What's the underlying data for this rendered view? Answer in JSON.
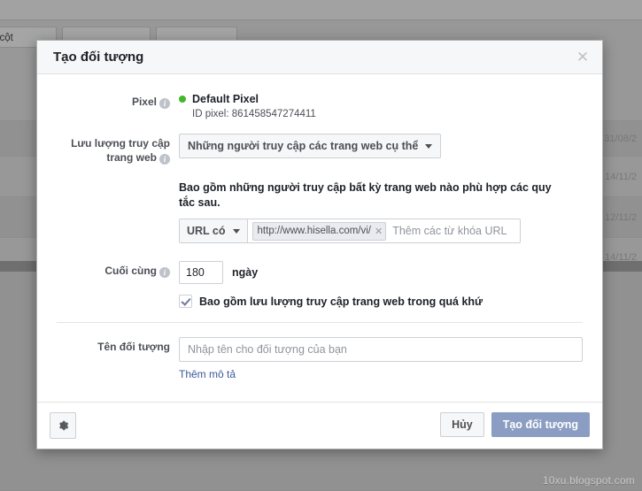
{
  "modal": {
    "title": "Tạo đối tượng",
    "close_icon": "close-icon",
    "pixel": {
      "label": "Pixel",
      "info_glyph": "i",
      "status_color": "#42b72a",
      "name": "Default Pixel",
      "id_text": "ID pixel: 861458547274411"
    },
    "traffic": {
      "label_line1": "Lưu lượng truy cập",
      "label_line2": "trang web",
      "info_glyph": "i",
      "selected_option": "Những người truy cập các trang web cụ thể"
    },
    "rule": {
      "description": "Bao gồm những người truy cập bất kỳ trang web nào phù hợp các quy tắc sau.",
      "operator": "URL có",
      "token_value": "http://www.hisella.com/vi/",
      "token_remove_icon": "remove-token-icon",
      "keywords_placeholder": "Thêm các từ khóa URL"
    },
    "duration": {
      "label": "Cuối cùng",
      "info_glyph": "i",
      "value": "180",
      "unit": "ngày",
      "checkbox_checked": true,
      "checkbox_label": "Bao gồm lưu lượng truy cập trang web trong quá khứ"
    },
    "audience_name": {
      "label": "Tên đối tượng",
      "value": "",
      "placeholder": "Nhập tên cho đối tượng của bạn",
      "add_description_link": "Thêm mô tả"
    },
    "footer": {
      "gear_icon": "gear-icon",
      "cancel_label": "Hủy",
      "create_label": "Tạo đối tượng",
      "create_color": "#8b9dc3"
    }
  },
  "background": {
    "buttons": [
      "inh cột",
      "",
      ""
    ],
    "dates": [
      "31/08/2",
      "14/11/2",
      "12/11/2",
      "14/11/2"
    ]
  },
  "watermark": "10xu.blogspot.com"
}
